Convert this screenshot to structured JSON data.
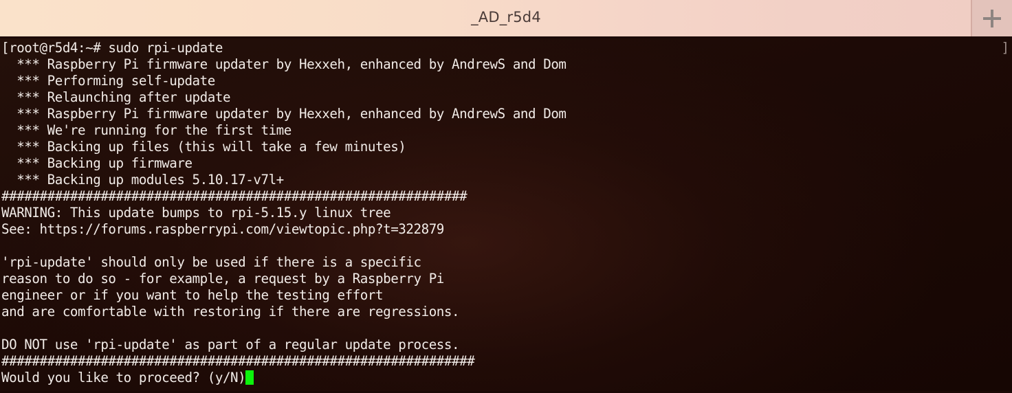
{
  "window": {
    "title": "_AD_r5d4",
    "titlebar_gradient_start": "#fae2ca",
    "titlebar_gradient_end": "#f0cdc4",
    "new_tab_label": "+"
  },
  "terminal": {
    "background": "#1d0a06",
    "foreground": "#f2ece8",
    "cursor_color": "#0cf20c",
    "right_edge_marker": "]",
    "lines": [
      "[root@r5d4:~# sudo rpi-update",
      "  *** Raspberry Pi firmware updater by Hexxeh, enhanced by AndrewS and Dom",
      "  *** Performing self-update",
      "  *** Relaunching after update",
      "  *** Raspberry Pi firmware updater by Hexxeh, enhanced by AndrewS and Dom",
      "  *** We're running for the first time",
      "  *** Backing up files (this will take a few minutes)",
      "  *** Backing up firmware",
      "  *** Backing up modules 5.10.17-v7l+",
      "#############################################################",
      "WARNING: This update bumps to rpi-5.15.y linux tree",
      "See: https://forums.raspberrypi.com/viewtopic.php?t=322879",
      "",
      "'rpi-update' should only be used if there is a specific",
      "reason to do so - for example, a request by a Raspberry Pi",
      "engineer or if you want to help the testing effort",
      "and are comfortable with restoring if there are regressions.",
      "",
      "DO NOT use 'rpi-update' as part of a regular update process.",
      "##############################################################",
      "Would you like to proceed? (y/N)"
    ],
    "prompt_line": "Would you like to proceed? (y/N)"
  }
}
